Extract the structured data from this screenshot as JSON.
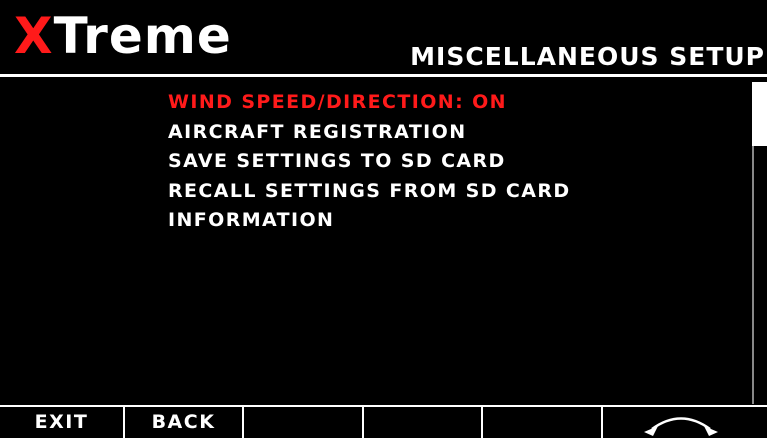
{
  "header": {
    "logo_accent": "X",
    "logo_rest": "Treme",
    "title": "MISCELLANEOUS SETUP"
  },
  "menu": {
    "items": [
      {
        "label": "WIND SPEED/DIRECTION: ON",
        "selected": true
      },
      {
        "label": "AIRCRAFT REGISTRATION",
        "selected": false
      },
      {
        "label": "SAVE SETTINGS TO SD CARD",
        "selected": false
      },
      {
        "label": "RECALL SETTINGS FROM SD CARD",
        "selected": false
      },
      {
        "label": "INFORMATION",
        "selected": false
      }
    ]
  },
  "softkeys": {
    "keys": [
      {
        "label": "EXIT"
      },
      {
        "label": "BACK"
      },
      {
        "label": ""
      },
      {
        "label": ""
      },
      {
        "label": ""
      },
      {
        "label": "",
        "icon": "rotary-knob-icon"
      }
    ]
  },
  "scroll": {
    "position_fraction": 0.0
  },
  "colors": {
    "background": "#000000",
    "text": "#ffffff",
    "accent": "#ff1a1a"
  }
}
